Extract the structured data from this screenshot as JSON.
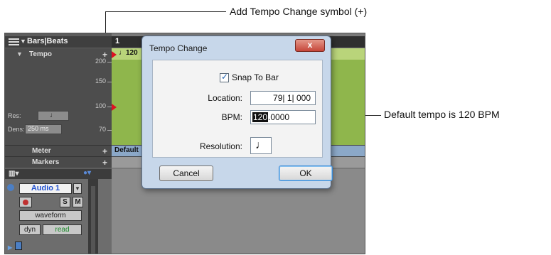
{
  "callouts": {
    "top": "Add Tempo Change symbol (+)",
    "right": "Default tempo is 120 BPM"
  },
  "left_panel": {
    "ruler_label": "Bars|Beats",
    "tempo_label": "Tempo",
    "tempo_ticks": [
      "200",
      "150",
      "100",
      "70"
    ],
    "res_label": "Res:",
    "res_value": "♩",
    "dens_label": "Dens:",
    "dens_value": "250 ms",
    "meter_label": "Meter",
    "markers_label": "Markers",
    "plus": "+"
  },
  "track": {
    "name": "Audio 1",
    "solo": "S",
    "mute": "M",
    "view": "waveform",
    "dyn": "dyn",
    "automation": "read"
  },
  "timeline": {
    "bar_number": "1",
    "tempo_marker": "♩120",
    "meter_default": "Default"
  },
  "dialog": {
    "title": "Tempo Change",
    "close": "x",
    "snap_to_bar_label": "Snap To Bar",
    "snap_to_bar_checked": true,
    "location_label": "Location:",
    "location_value": "79| 1| 000",
    "bpm_label": "BPM:",
    "bpm_selected": "120",
    "bpm_rest": ".0000",
    "resolution_label": "Resolution:",
    "resolution_value": "♩",
    "cancel_label": "Cancel",
    "ok_label": "OK"
  }
}
